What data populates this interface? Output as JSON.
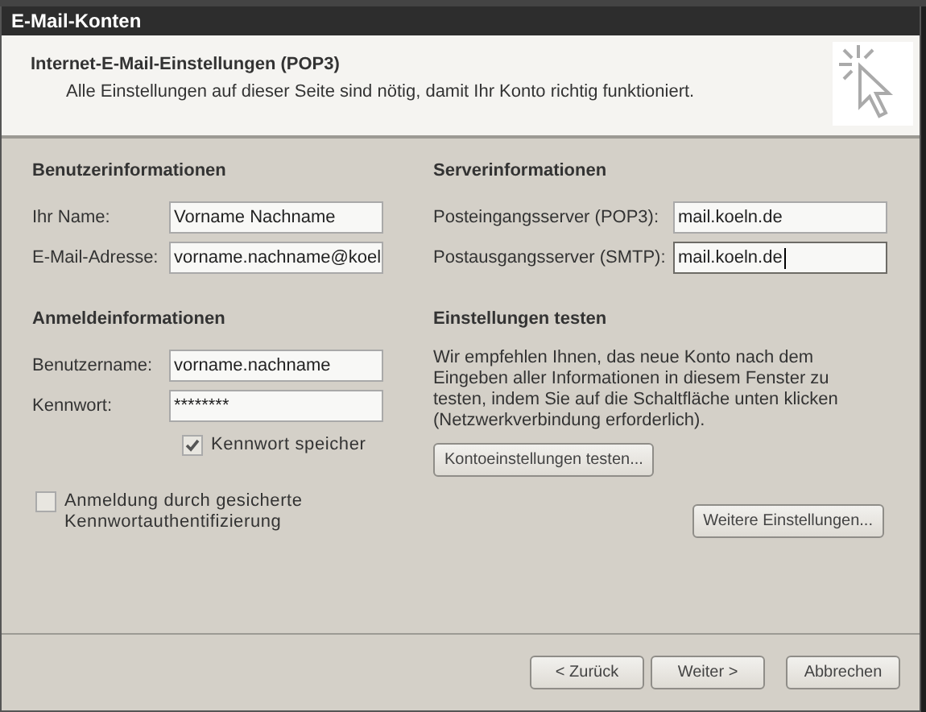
{
  "window": {
    "title": "E-Mail-Konten"
  },
  "header": {
    "title": "Internet-E-Mail-Einstellungen (POP3)",
    "subtitle": "Alle Einstellungen auf dieser Seite sind nötig, damit Ihr Konto richtig funktioniert."
  },
  "user_info": {
    "heading": "Benutzerinformationen",
    "fields": [
      {
        "label": "Ihr Name:",
        "value": "Vorname Nachname",
        "focused": false
      },
      {
        "label": "E-Mail-Adresse:",
        "value": "vorname.nachname@koel",
        "focused": false
      }
    ]
  },
  "server_info": {
    "heading": "Serverinformationen",
    "fields": [
      {
        "label": "Posteingangsserver (POP3):",
        "value": "mail.koeln.de",
        "focused": false
      },
      {
        "label": "Postausgangsserver (SMTP):",
        "value": "mail.koeln.de",
        "focused": true
      }
    ]
  },
  "login_info": {
    "heading": "Anmeldeinformationen",
    "fields": [
      {
        "label": "Benutzername:",
        "value": "vorname.nachname",
        "focused": false
      },
      {
        "label": "Kennwort:",
        "value": "********",
        "focused": false
      }
    ],
    "remember": {
      "label": "Kennwort speicher",
      "checked": true
    },
    "spa": {
      "label": "Anmeldung durch gesicherte Kennwortauthentifizierung",
      "checked": false
    }
  },
  "test": {
    "heading": "Einstellungen testen",
    "text": "Wir empfehlen Ihnen, das neue Konto nach dem Eingeben aller Informationen in diesem Fenster zu testen, indem Sie auf die Schaltfläche unten klicken (Netzwerkverbindung erforderlich).",
    "button": "Kontoeinstellungen testen..."
  },
  "more_button": "Weitere Einstellungen...",
  "buttons": [
    "< Zurück",
    "Weiter >",
    "Abbrechen"
  ]
}
